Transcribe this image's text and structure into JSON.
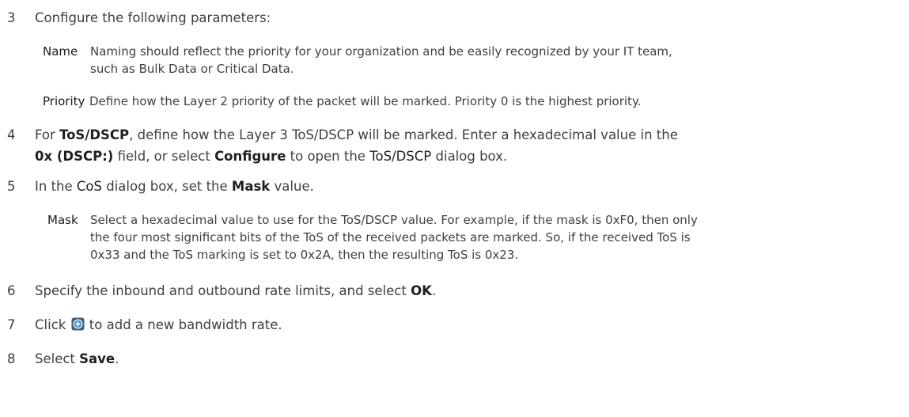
{
  "steps": [
    {
      "num": "3",
      "text": "Configure the following parameters:"
    },
    {
      "num": "4",
      "prefix": "For ",
      "bold1": "ToS/DSCP",
      "mid1": ", define how the Layer 3 ToS/DSCP will be marked. Enter a hexadecimal value in the",
      "bold2": "0x (DSCP:)",
      "mid2": " field, or select ",
      "bold3": "Configure",
      "mid3": " to open the ",
      "term": "ToS/DSCP",
      "suffix": " dialog box."
    },
    {
      "num": "5",
      "prefix": "In the ",
      "term": "CoS",
      "mid": " dialog box, set the ",
      "bold": "Mask",
      "suffix": " value."
    },
    {
      "num": "6",
      "prefix": "Specify the inbound and outbound rate limits, and select ",
      "bold": "OK",
      "suffix": "."
    },
    {
      "num": "7",
      "prefix": "Click ",
      "icon": "add-circle-icon",
      "suffix": " to add a new bandwidth rate."
    },
    {
      "num": "8",
      "prefix": "Select ",
      "bold": "Save",
      "suffix": "."
    }
  ],
  "params": [
    {
      "term": "Name",
      "line1": "Naming should reflect the priority for your organization and be easily recognized by your IT team,",
      "line2": "such as Bulk Data or Critical Data."
    },
    {
      "term": "Priority",
      "line1": "Define how the Layer 2 priority of the packet will be marked. Priority 0 is the highest priority."
    }
  ],
  "mask": {
    "term": "Mask",
    "line1": "Select a hexadecimal value to use for the ToS/DSCP value. For example, if the mask is 0xF0, then only",
    "line2": "the four most significant bits of the ToS of the received packets are marked. So, if the received ToS is",
    "line3": "0x33 and the ToS marking is set to 0x2A, then the resulting ToS is 0x23."
  },
  "colors": {
    "text": "#3f3f3f",
    "icon_fill": "#5a6a7a",
    "icon_ring": "#2f8fd6"
  }
}
